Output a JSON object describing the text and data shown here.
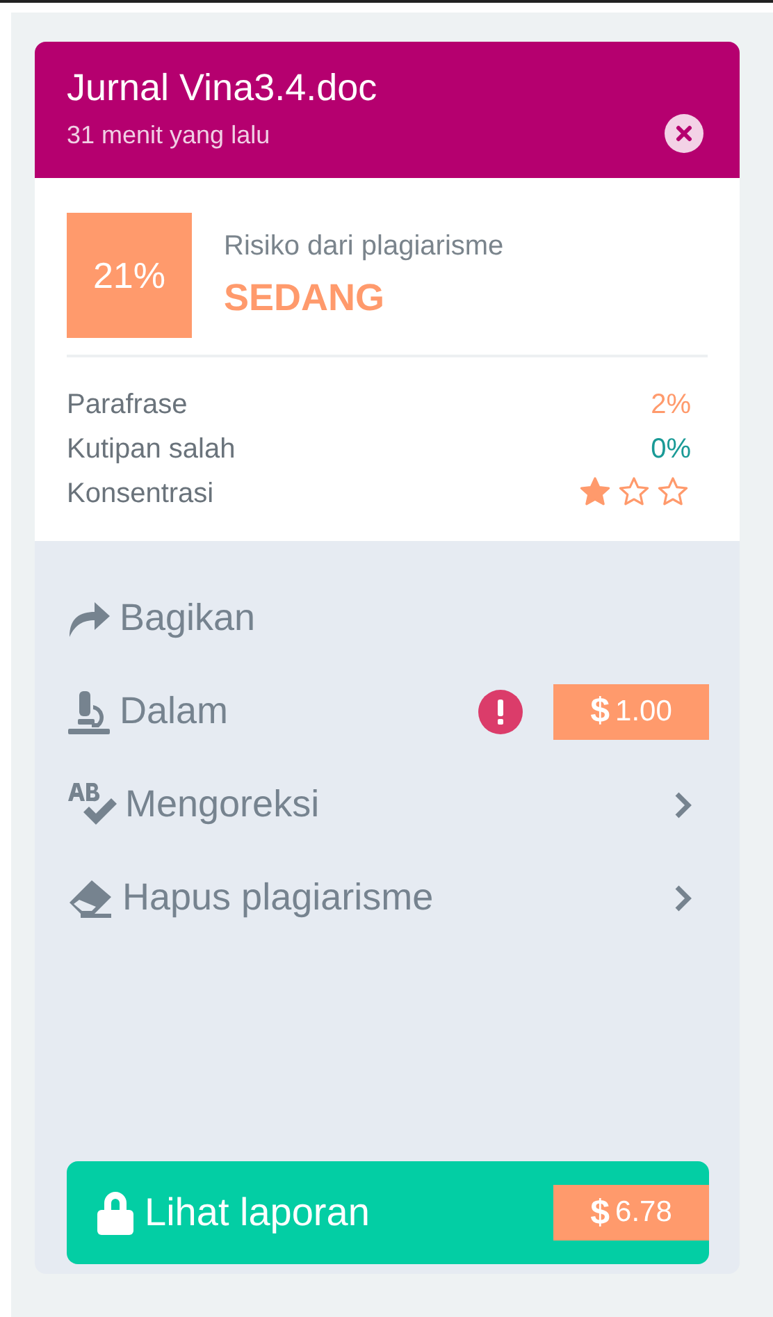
{
  "document": {
    "title": "Jurnal Vina3.4.doc",
    "time": "31 menit yang lalu"
  },
  "risk": {
    "score": "21%",
    "label": "Risiko dari plagiarisme",
    "level_text": "SEDANG"
  },
  "metrics": [
    {
      "kind": "value",
      "name": "Parafrase",
      "value": "2%",
      "color": "#ff9a6c"
    },
    {
      "kind": "value",
      "name": "Kutipan salah",
      "value": "0%",
      "color": "#1a9a96"
    },
    {
      "kind": "stars",
      "name": "Konsentrasi",
      "stars": 1
    }
  ],
  "actions": [
    {
      "kind": "plain",
      "label": "Bagikan"
    },
    {
      "kind": "priced",
      "label": "Dalam",
      "warning": true,
      "price": "**$** 1.00"
    },
    {
      "kind": "submenu",
      "label": "Mengoreksi"
    },
    {
      "kind": "submenu",
      "label": "Hapus plagiarisme"
    }
  ],
  "report_button": {
    "label": "Lihat laporan",
    "locked": true,
    "price": "**$** 6.78"
  }
}
